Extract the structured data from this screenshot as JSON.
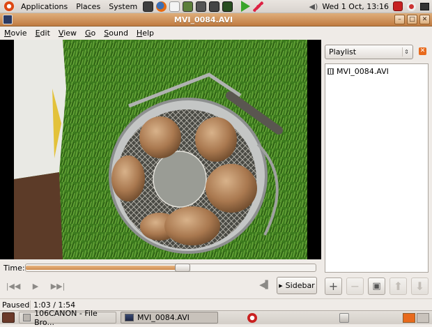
{
  "top_panel": {
    "menus": [
      "Applications",
      "Places",
      "System"
    ],
    "clock": "Wed  1 Oct, 13:16"
  },
  "window": {
    "title": "MVI_0084.AVI"
  },
  "menubar": [
    {
      "label": "Movie",
      "underline": "M",
      "rest": "ovie"
    },
    {
      "label": "Edit",
      "underline": "E",
      "rest": "dit"
    },
    {
      "label": "View",
      "underline": "V",
      "rest": "iew"
    },
    {
      "label": "Go",
      "underline": "G",
      "rest": "o"
    },
    {
      "label": "Sound",
      "underline": "S",
      "rest": "ound"
    },
    {
      "label": "Help",
      "underline": "H",
      "rest": "elp"
    }
  ],
  "player": {
    "time_label": "Time:",
    "progress": 0.54,
    "sidebar_button": "Sidebar"
  },
  "sidebar": {
    "combo_value": "Playlist",
    "items": [
      "MVI_0084.AVI"
    ]
  },
  "status": {
    "state": "Paused",
    "position": "1:03 / 1:54"
  },
  "taskbar": {
    "items": [
      "106CANON - File Bro...",
      "MVI_0084.AVI"
    ]
  },
  "colors": {
    "title_accent": "#c07b41",
    "seek_fill": "#cf8b4e"
  }
}
